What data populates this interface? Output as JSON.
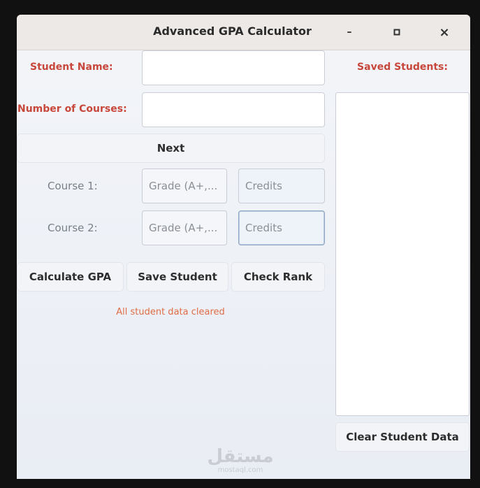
{
  "window": {
    "title": "Advanced GPA Calculator",
    "controls": {
      "minimize": "–",
      "maximize": "▫",
      "close": "×"
    }
  },
  "form": {
    "student_name_label": "Student Name:",
    "student_name_value": "",
    "courses_label": "Number of Courses:",
    "courses_value": "",
    "next_label": "Next"
  },
  "courses": [
    {
      "label": "Course 1:",
      "grade_placeholder": "Grade (A+,...",
      "credits_placeholder": "Credits"
    },
    {
      "label": "Course 2:",
      "grade_placeholder": "Grade (A+,...",
      "credits_placeholder": "Credits"
    }
  ],
  "actions": {
    "calculate_label": "Calculate GPA",
    "save_label": "Save Student",
    "rank_label": "Check Rank"
  },
  "status_message": "All student data cleared",
  "sidebar": {
    "title": "Saved Students:",
    "items": [],
    "clear_label": "Clear Student Data"
  },
  "watermark": {
    "arabic": "مستقل",
    "domain": "mostaql.com"
  },
  "colors": {
    "label_red": "#c8473b",
    "status_orange": "#e06c45",
    "window_bg": "#eef1f6",
    "titlebar_bg": "#ece9e6"
  }
}
